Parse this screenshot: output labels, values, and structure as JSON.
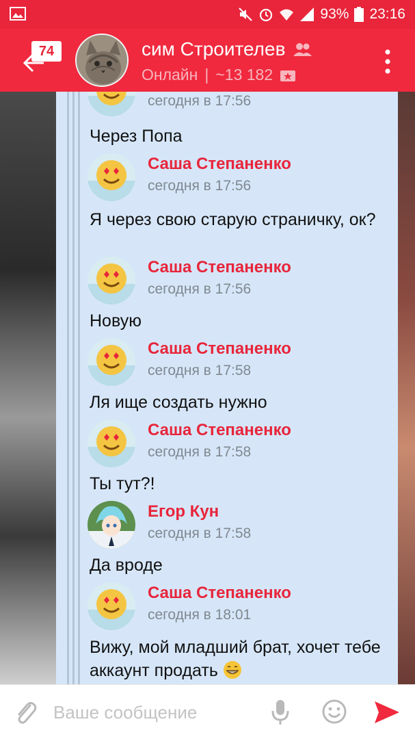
{
  "status_bar": {
    "battery": "93%",
    "time": "23:16",
    "icons": [
      "image-icon",
      "mute-icon",
      "alarm-icon",
      "wifi-icon",
      "signal-icon",
      "battery-icon"
    ]
  },
  "header": {
    "unread_badge": "74",
    "title": "сим Строителев",
    "subtitle_status": "Онлайн",
    "subtitle_sep": "|",
    "subtitle_count": "~13 182",
    "accent_color": "#f0293e"
  },
  "messages": [
    {
      "time": "сегодня в 17:56",
      "text": "Через Попа",
      "avatar": "heart-eyes"
    },
    {
      "sender": "Саша Степаненко",
      "time": "сегодня в 17:56",
      "text": "Я через свою старую страничку, ок?",
      "avatar": "heart-eyes"
    },
    {
      "sender": "Саша Степаненко",
      "time": "сегодня в 17:56",
      "text": "Новую",
      "avatar": "heart-eyes"
    },
    {
      "sender": "Саша Степаненко",
      "time": "сегодня в 17:58",
      "text": "Ля ище создать нужно",
      "avatar": "heart-eyes"
    },
    {
      "sender": "Саша Степаненко",
      "time": "сегодня в 17:58",
      "text": "Ты тут?!",
      "avatar": "heart-eyes"
    },
    {
      "sender": "Егор Кун",
      "time": "сегодня в 17:58",
      "text": "Да вроде",
      "avatar": "anime"
    },
    {
      "sender": "Саша Степаненко",
      "time": "сегодня в 18:01",
      "text": "Вижу, мой младший брат, хочет тебе аккаунт продать",
      "avatar": "heart-eyes",
      "trailing_emoji": "grin-emoji"
    }
  ],
  "compose": {
    "placeholder": "Ваше сообщение"
  }
}
